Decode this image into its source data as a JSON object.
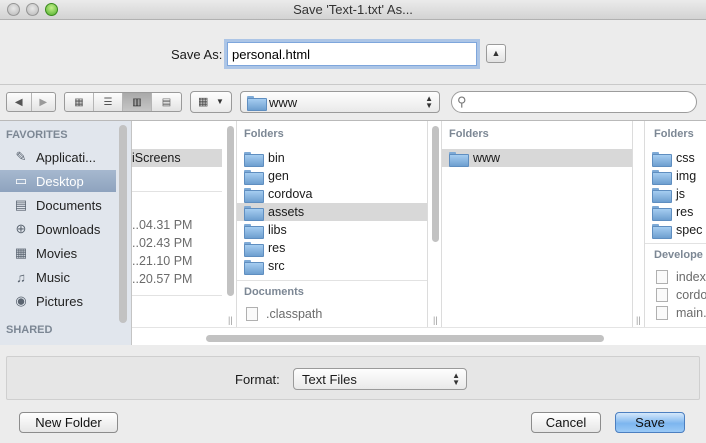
{
  "window": {
    "title": "Save 'Text-1.txt' As..."
  },
  "save_as": {
    "label": "Save As:",
    "value": "personal.html"
  },
  "toolbar": {
    "location": "www",
    "search_placeholder": ""
  },
  "sidebar": {
    "favorites_header": "FAVORITES",
    "shared_header": "SHARED",
    "items": [
      {
        "label": "Applicati...",
        "icon": "applications-icon",
        "selected": false
      },
      {
        "label": "Desktop",
        "icon": "desktop-icon",
        "selected": true
      },
      {
        "label": "Documents",
        "icon": "documents-icon",
        "selected": false
      },
      {
        "label": "Downloads",
        "icon": "downloads-icon",
        "selected": false
      },
      {
        "label": "Movies",
        "icon": "movies-icon",
        "selected": false
      },
      {
        "label": "Music",
        "icon": "music-icon",
        "selected": false
      },
      {
        "label": "Pictures",
        "icon": "pictures-icon",
        "selected": false
      }
    ]
  },
  "columns": {
    "col0": {
      "selected_item": "iScreens",
      "times": [
        "..04.31 PM",
        "..02.43 PM",
        "..21.10 PM",
        "..20.57 PM"
      ]
    },
    "col1": {
      "folders_header": "Folders",
      "folders": [
        "bin",
        "gen",
        "cordova",
        "assets",
        "libs",
        "res",
        "src"
      ],
      "selected": "assets",
      "documents_header": "Documents",
      "documents": [
        ".classpath"
      ]
    },
    "col2": {
      "folders_header": "Folders",
      "folders": [
        "www"
      ],
      "selected": "www"
    },
    "col3": {
      "folders_header": "Folders",
      "folders": [
        "css",
        "img",
        "js",
        "res",
        "spec"
      ],
      "developer_header": "Develope",
      "files": [
        "index",
        "cordo",
        "main."
      ]
    }
  },
  "format": {
    "label": "Format:",
    "value": "Text Files"
  },
  "buttons": {
    "new_folder": "New Folder",
    "cancel": "Cancel",
    "save": "Save"
  },
  "colors": {
    "accent": "#7db6ef",
    "sidebar_bg": "#e1e6ed",
    "selection": "#d8d8d8"
  }
}
